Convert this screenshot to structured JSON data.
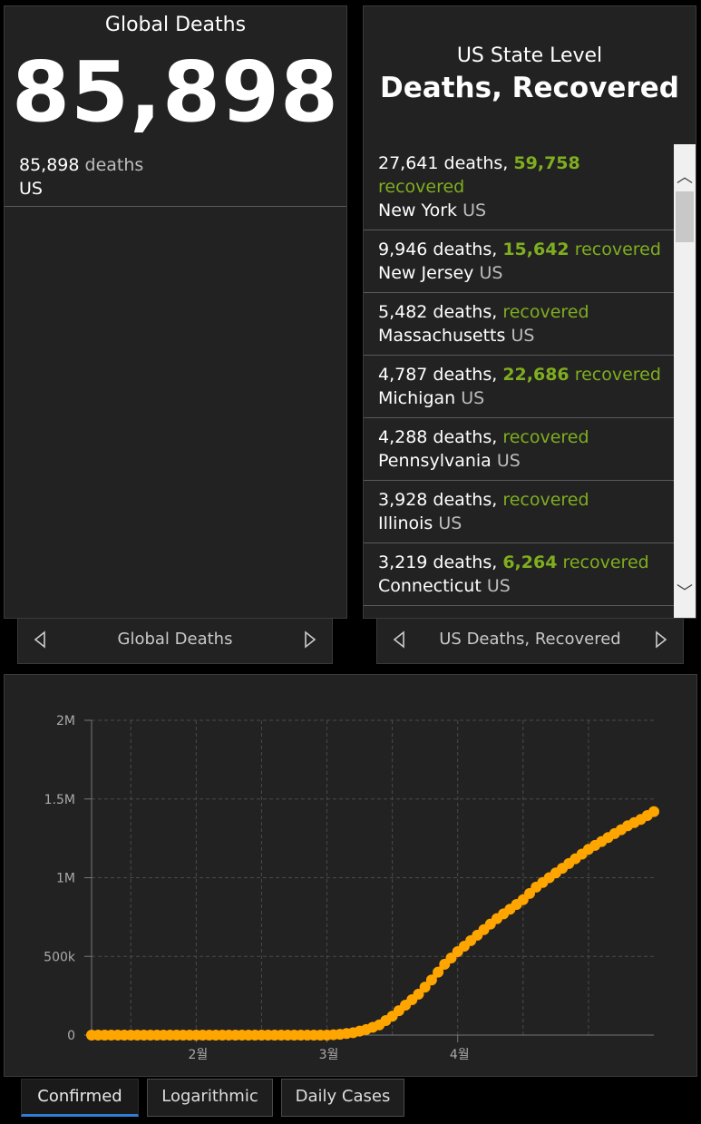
{
  "left_panel": {
    "title": "Global Deaths",
    "total": "85,898",
    "entry_value": "85,898",
    "entry_unit": "deaths",
    "entry_place": "US",
    "nav_label": "Global Deaths"
  },
  "right_panel": {
    "subtitle": "US State Level",
    "heading": "Deaths, Recovered",
    "nav_label": "US Deaths, Recovered",
    "rows": [
      {
        "deaths": "27,641 deaths,",
        "recovered_num": "59,758",
        "recovered_word": "recovered",
        "state": "New York",
        "country": "US"
      },
      {
        "deaths": "9,946 deaths,",
        "recovered_num": "15,642",
        "recovered_word": "recovered",
        "state": "New Jersey",
        "country": "US"
      },
      {
        "deaths": "5,482 deaths,",
        "recovered_num": "",
        "recovered_word": "recovered",
        "state": "Massachusetts",
        "country": "US"
      },
      {
        "deaths": "4,787 deaths,",
        "recovered_num": "22,686",
        "recovered_word": "recovered",
        "state": "Michigan",
        "country": "US"
      },
      {
        "deaths": "4,288 deaths,",
        "recovered_num": "",
        "recovered_word": "recovered",
        "state": "Pennsylvania",
        "country": "US"
      },
      {
        "deaths": "3,928 deaths,",
        "recovered_num": "",
        "recovered_word": "recovered",
        "state": "Illinois",
        "country": "US"
      },
      {
        "deaths": "3,219 deaths,",
        "recovered_num": "6,264",
        "recovered_word": "recovered",
        "state": "Connecticut",
        "country": "US"
      }
    ]
  },
  "chart_data": {
    "type": "line",
    "x_ticks": [
      "2월",
      "3월",
      "4월"
    ],
    "y_ticks": [
      "0",
      "500k",
      "1M",
      "1.5M",
      "2M"
    ],
    "ylim": [
      0,
      2000000
    ],
    "xlim_days": [
      0,
      86
    ],
    "x_tick_days": [
      16,
      36,
      56
    ],
    "series_color": "#ffa500",
    "grid": true,
    "series": [
      {
        "name": "",
        "x_days": [
          0,
          10,
          20,
          30,
          36,
          38,
          40,
          42,
          44,
          46,
          48,
          50,
          52,
          54,
          56,
          58,
          60,
          62,
          64,
          66,
          68,
          70,
          72,
          74,
          76,
          78,
          80,
          82,
          84,
          86
        ],
        "values": [
          0,
          0,
          0,
          0,
          0,
          5000,
          15000,
          35000,
          65000,
          120000,
          190000,
          260000,
          350000,
          450000,
          530000,
          600000,
          670000,
          740000,
          800000,
          860000,
          940000,
          1000000,
          1060000,
          1120000,
          1180000,
          1230000,
          1280000,
          1330000,
          1370000,
          1420000
        ]
      }
    ]
  },
  "tabs": {
    "confirmed": "Confirmed",
    "logarithmic": "Logarithmic",
    "daily": "Daily Cases"
  }
}
